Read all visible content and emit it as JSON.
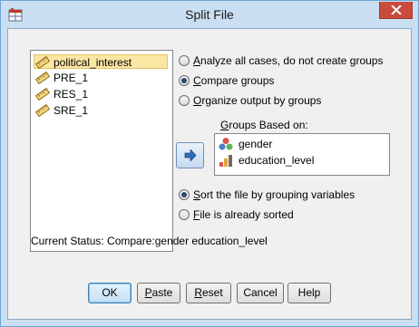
{
  "window": {
    "title": "Split File"
  },
  "icons": {
    "app": "spss-split-file-icon",
    "close": "close-icon",
    "scale_var": "ruler-scale-icon",
    "nominal": "nominal-icon",
    "ordinal": "ordinal-bar-icon",
    "move": "arrow-right-icon"
  },
  "variables": [
    {
      "label": "political_interest",
      "selected": true
    },
    {
      "label": "PRE_1",
      "selected": false
    },
    {
      "label": "RES_1",
      "selected": false
    },
    {
      "label": "SRE_1",
      "selected": false
    }
  ],
  "mode_options": {
    "analyze_all": {
      "pre": "",
      "u": "A",
      "post": "nalyze all cases, do not create groups",
      "checked": false
    },
    "compare": {
      "pre": "",
      "u": "C",
      "post": "ompare groups",
      "checked": true
    },
    "organize": {
      "pre": "",
      "u": "O",
      "post": "rganize output by groups",
      "checked": false
    }
  },
  "groups": {
    "label_pre": "",
    "label_u": "G",
    "label_post": "roups Based on:",
    "items": [
      {
        "label": "gender"
      },
      {
        "label": "education_level"
      }
    ]
  },
  "sort_options": {
    "sort": {
      "pre": "",
      "u": "S",
      "post": "ort the file by grouping variables",
      "checked": true
    },
    "sorted": {
      "pre": "",
      "u": "F",
      "post": "ile is already sorted",
      "checked": false
    }
  },
  "status": {
    "text": "Current Status: Compare:gender education_level"
  },
  "buttons": {
    "ok": "OK",
    "paste_u": "P",
    "paste_rest": "aste",
    "reset_u": "R",
    "reset_rest": "eset",
    "cancel": "Cancel",
    "help": "Help"
  },
  "colors": {
    "frame": "#cbdff2",
    "close": "#c84b3c",
    "selected_bg": "#fbe6a4"
  }
}
